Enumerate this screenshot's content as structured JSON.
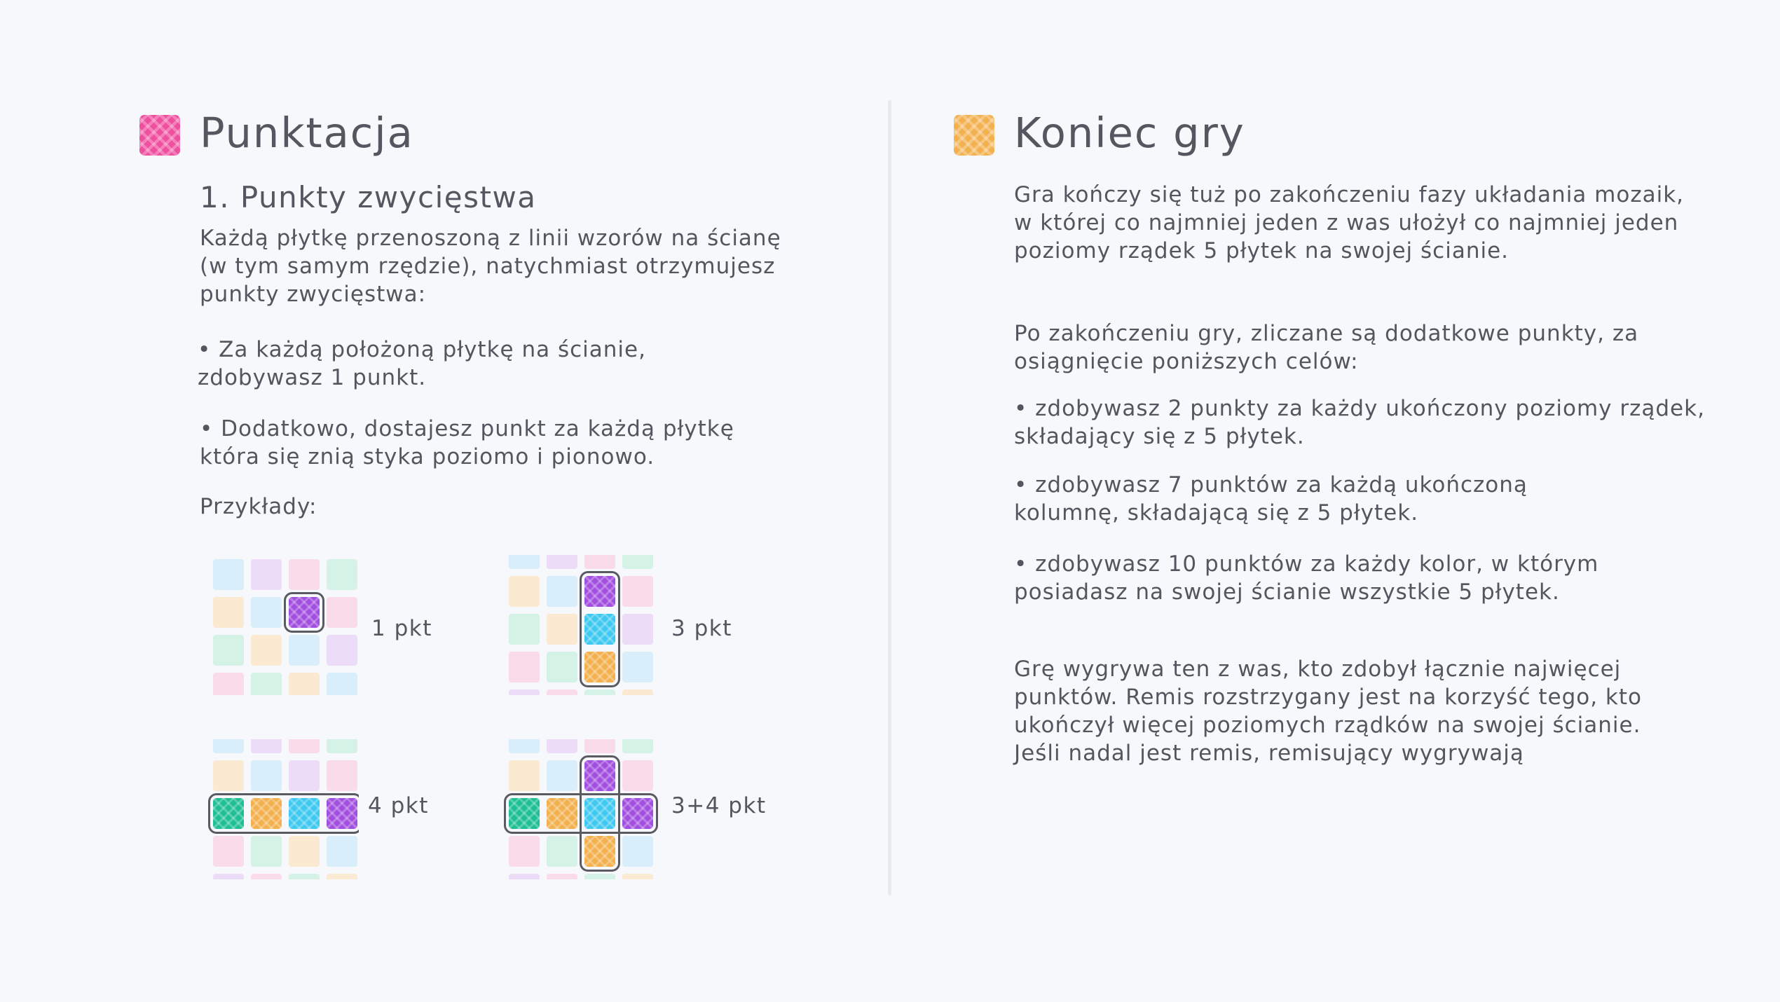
{
  "left": {
    "title": "Punktacja",
    "subtitle": "1. Punkty zwycięstwa",
    "intro": "Każdą płytkę przenoszoną z linii wzorów na ścianę\n(w tym samym rzędzie), natychmiast otrzymujesz\npunkty zwycięstwa:",
    "bullet1": "• Za każdą położoną płytkę na ścianie,\nzdobywasz 1 punkt.",
    "bullet2": "• Dodatkowo, dostajesz punkt za każdą płytkę\nktóra się znią styka poziomo i pionowo.",
    "examples_label": "Przykłady:",
    "examples": [
      {
        "label": "1 pkt"
      },
      {
        "label": "3 pkt"
      },
      {
        "label": "4 pkt"
      },
      {
        "label": "3+4 pkt"
      }
    ]
  },
  "right": {
    "title": "Koniec gry",
    "p1": "Gra kończy się tuż po zakończeniu fazy układania mozaik,\nw której co najmniej jeden z was ułożył co najmniej jeden\npoziomy rządek 5 płytek na swojej ścianie.",
    "p2": "Po zakończeniu gry, zliczane są dodatkowe punkty, za\nosiągnięcie poniższych celów:",
    "b1": "• zdobywasz 2 punkty za każdy ukończony poziomy rządek,\nskładający się z 5 płytek.",
    "b2": "• zdobywasz 7 punktów za każdą ukończoną\nkolumnę, składającą się z 5 płytek.",
    "b3": "• zdobywasz 10 punktów za każdy kolor, w którym\nposiadasz na swojej ścianie wszystkie 5 płytek.",
    "p3": "Grę wygrywa ten z was, kto zdobył łącznie najwięcej\npunktów. Remis rozstrzygany jest na korzyść tego, kto\nukończył więcej poziomych rządków na swojej ścianie.\nJeśli nadal jest remis, remisujący wygrywają"
  },
  "colors": {
    "pink": "#ee4f9f",
    "orange": "#f3b04e",
    "purple": "#a24fe0",
    "cyan": "#3fc8f0",
    "teal": "#1fbf94",
    "outline": "#5a5a63"
  }
}
